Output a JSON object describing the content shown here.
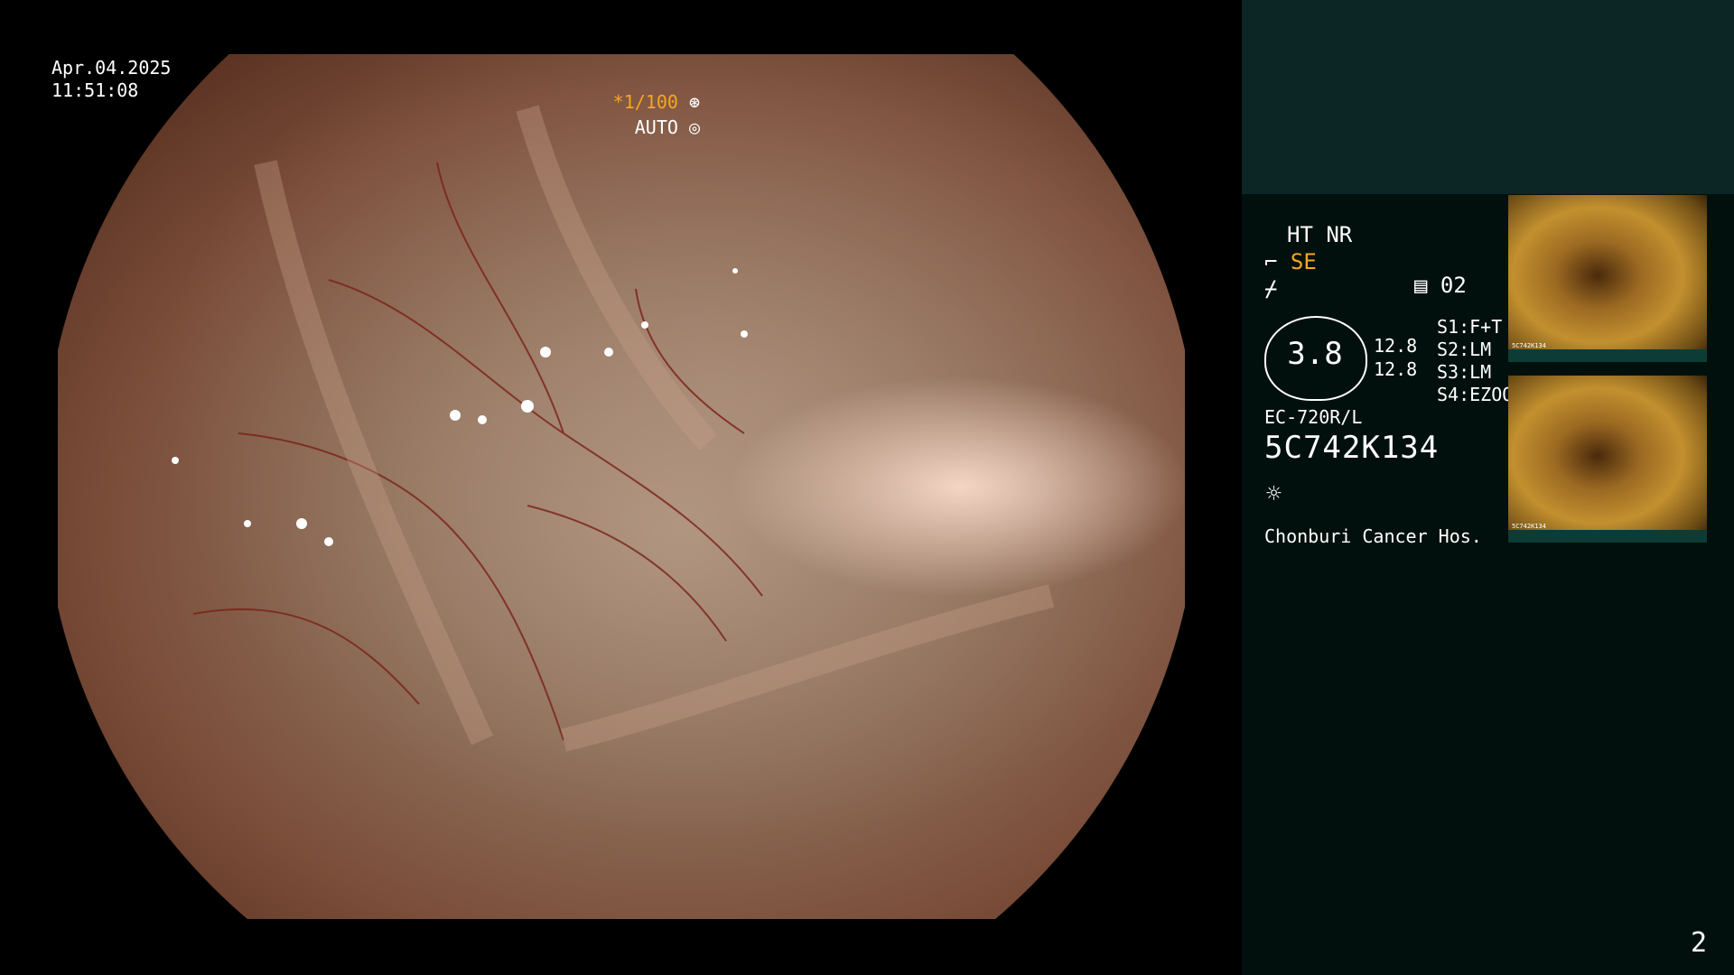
{
  "overlay": {
    "date": "Apr.04.2025",
    "time": "11:51:08",
    "shutter": "*1/100",
    "iris": "AUTO"
  },
  "panel": {
    "mode_line": "HT NR",
    "enhance": "SE",
    "counter": "02",
    "scale_value": "3.8",
    "sub_value_1": "12.8",
    "sub_value_2": "12.8",
    "s_items": [
      {
        "key": "S1:",
        "val": "F+T"
      },
      {
        "key": "S2:",
        "val": "LM"
      },
      {
        "key": "S3:",
        "val": "LM"
      },
      {
        "key": "S4:",
        "val": "EZOOM"
      }
    ],
    "model": "EC-720R/L",
    "serial": "5C742K134",
    "hospital": "Chonburi Cancer Hos."
  },
  "thumbnails": [
    {
      "caption": "5C742K134"
    },
    {
      "caption": "5C742K134"
    }
  ],
  "page_number": "2",
  "icons": [
    "aperture-icon",
    "iris-icon",
    "scope-mode-icon",
    "gain-icon",
    "memory-icon",
    "light-icon"
  ]
}
